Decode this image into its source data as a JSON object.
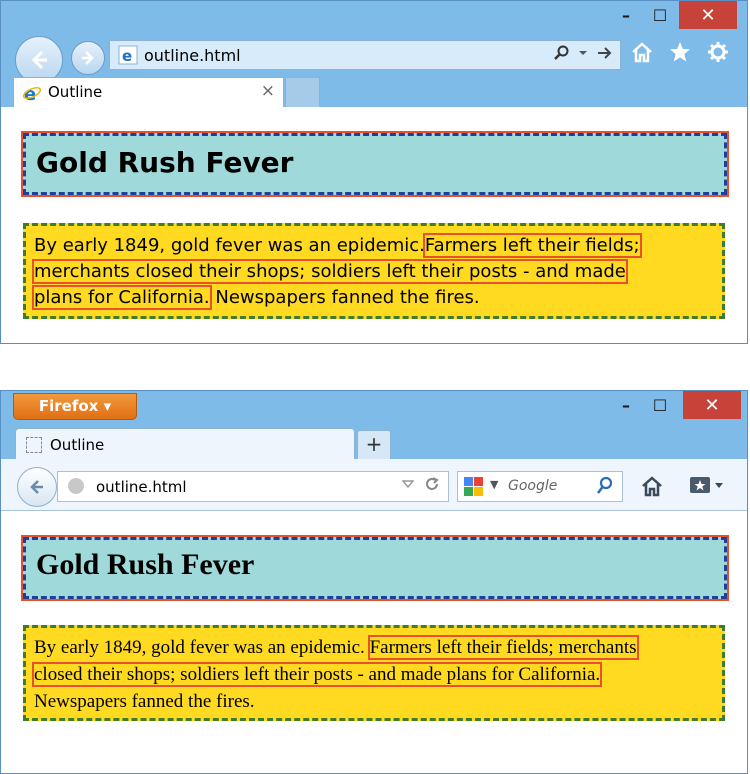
{
  "ie": {
    "window_controls": {
      "min": "–",
      "max": "☐",
      "close": "✕"
    },
    "address": "outline.html",
    "tab_label": "Outline",
    "tab_close": "×",
    "heading": "Gold Rush Fever",
    "para": {
      "part1": "By early 1849, gold fever was an epidemic.",
      "part2": "Farmers left their fields;",
      "part3": "merchants closed their shops; soldiers left their posts - and made",
      "part4": "plans for California.",
      "part5": " Newspapers fanned the fires."
    }
  },
  "firefox": {
    "menu_button": "Firefox ▾",
    "window_controls": {
      "min": "–",
      "max": "☐",
      "close": "✕"
    },
    "tab_label": "Outline",
    "new_tab": "+",
    "address": "outline.html",
    "search_placeholder": "Google",
    "heading": "Gold Rush Fever",
    "para": {
      "part1": "By early 1849, gold fever was an epidemic.",
      "part2": "Farmers left their fields; merchants",
      "part3": "closed their shops; soldiers left their posts - and made plans for California.",
      "part4": "Newspapers fanned the fires."
    }
  },
  "colors": {
    "chrome": "#7fbbe8",
    "close": "#c7433a",
    "h1_bg": "#9fd9d9",
    "p_bg": "#ffda20",
    "outline": "#e8502e",
    "h1_border": "#1e3f9e",
    "p_border": "#3f7d2c"
  }
}
